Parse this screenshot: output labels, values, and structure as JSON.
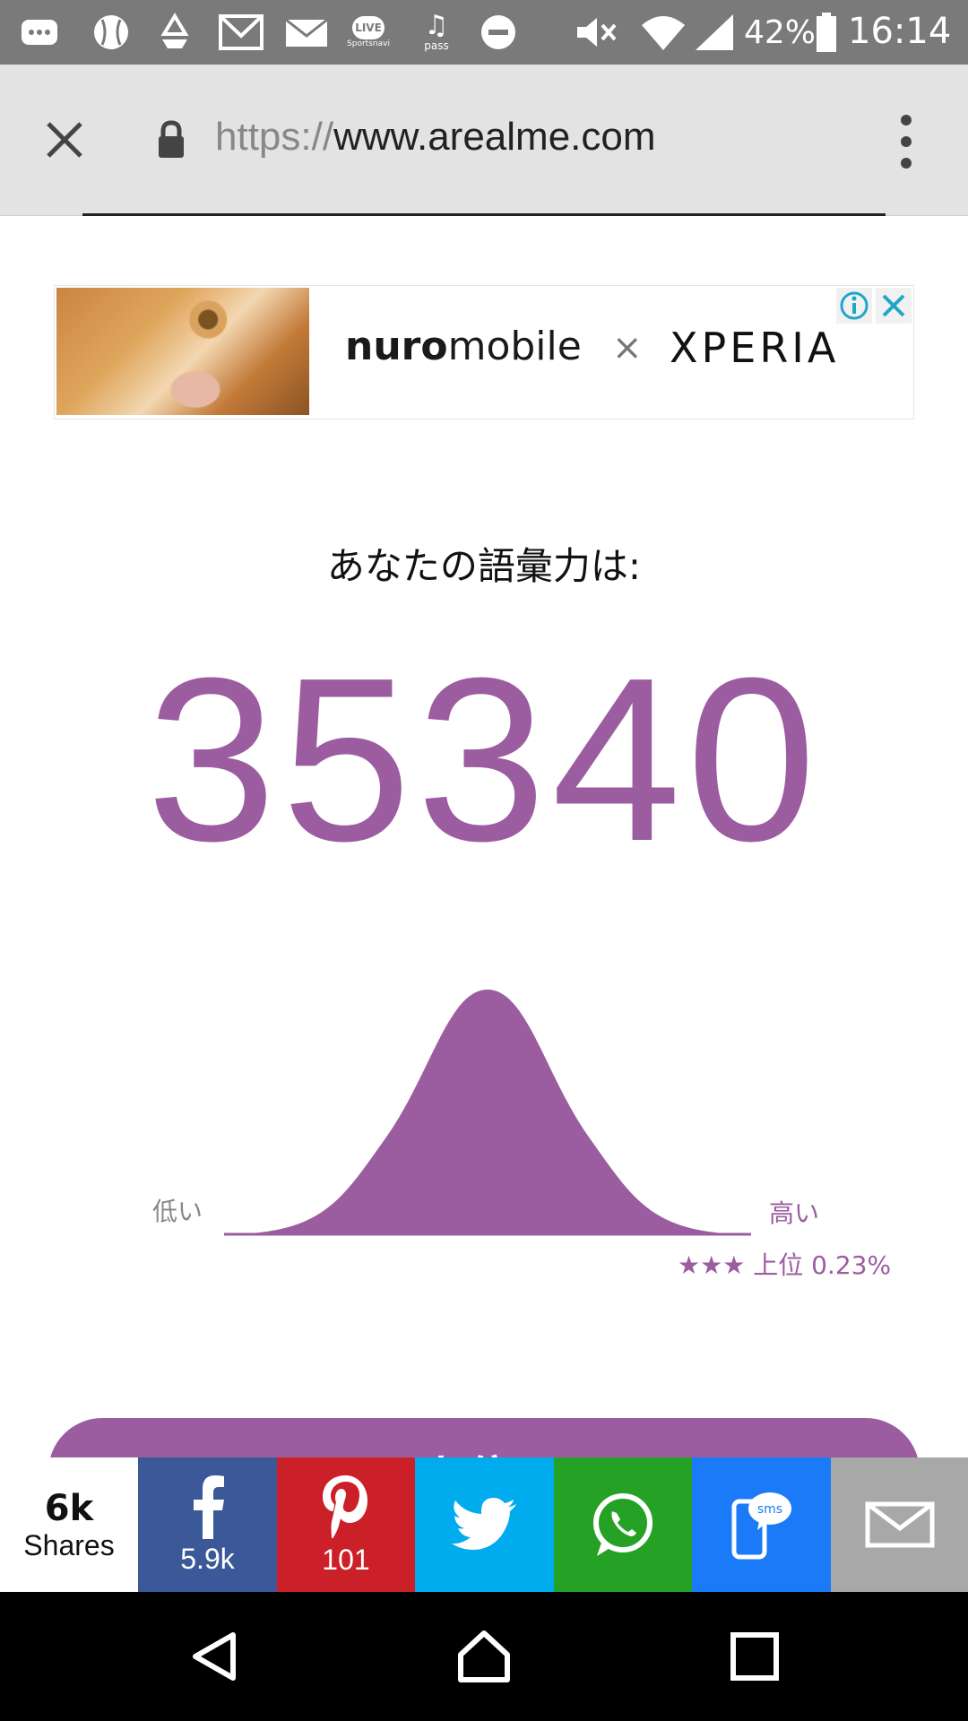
{
  "status_bar": {
    "battery_percent": "42%",
    "time": "16:14",
    "live_badge": "LIVE",
    "pass_label": "pass",
    "sportsnavi_label": "Sportsnavi"
  },
  "browser": {
    "url_scheme": "https://",
    "url_host": "www.arealme.com"
  },
  "ad": {
    "brand_bold": "nuro",
    "brand_light": "mobile",
    "times": "×",
    "partner": "XPERIA"
  },
  "result": {
    "label": "あなたの語彙力は:",
    "score": "35340",
    "low_label": "低い",
    "high_label": "高い",
    "rank_stars": "★★★",
    "rank_text": "上位 0.23%",
    "peek_text": "★★★ 上位 0.23%",
    "marker_position_fraction": 0.9977
  },
  "share": {
    "total": "6k",
    "total_label": "Shares",
    "facebook_count": "5.9k",
    "pinterest_count": "101"
  },
  "colors": {
    "accent": "#9b5da0",
    "facebook": "#3b5998",
    "pinterest": "#cb2027",
    "twitter": "#00aced",
    "whatsapp": "#25a125",
    "sms": "#1a7af8",
    "email": "#a8a8a8"
  }
}
